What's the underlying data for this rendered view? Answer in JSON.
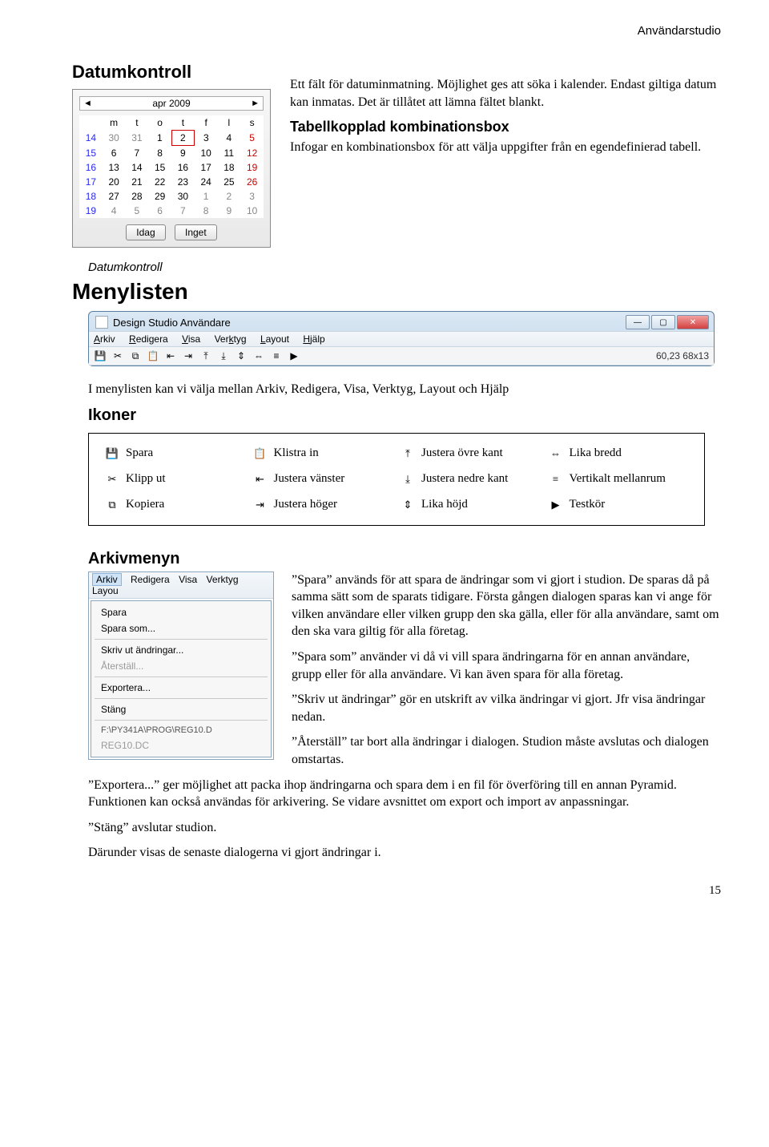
{
  "running_head": "Användarstudio",
  "datumkontroll": {
    "title": "Datumkontroll",
    "para1": "Ett fält för datuminmatning. Möjlighet ges att söka i kalender. Endast giltiga datum kan inmatas. Det är tillåtet att lämna fältet blankt.",
    "sub_title": "Tabellkopplad kombinationsbox",
    "para2": "Infogar en kombinationsbox för att välja uppgifter från en egendefinierad tabell.",
    "caption": "Datumkontroll"
  },
  "calendar": {
    "month": "apr 2009",
    "prev": "◄",
    "next": "►",
    "dow": [
      "m",
      "t",
      "o",
      "t",
      "f",
      "l",
      "s"
    ],
    "rows": [
      {
        "wk": "14",
        "d": [
          "30",
          "31",
          "1",
          "2",
          "3",
          "4",
          "5"
        ],
        "dim": [
          0,
          1
        ],
        "today": 3,
        "red": [
          6
        ]
      },
      {
        "wk": "15",
        "d": [
          "6",
          "7",
          "8",
          "9",
          "10",
          "11",
          "12"
        ],
        "red": [
          6
        ]
      },
      {
        "wk": "16",
        "d": [
          "13",
          "14",
          "15",
          "16",
          "17",
          "18",
          "19"
        ],
        "red": [
          6
        ]
      },
      {
        "wk": "17",
        "d": [
          "20",
          "21",
          "22",
          "23",
          "24",
          "25",
          "26"
        ],
        "red": [
          6
        ]
      },
      {
        "wk": "18",
        "d": [
          "27",
          "28",
          "29",
          "30",
          "1",
          "2",
          "3"
        ],
        "dim": [
          4,
          5,
          6
        ],
        "red": [
          6
        ]
      },
      {
        "wk": "19",
        "d": [
          "4",
          "5",
          "6",
          "7",
          "8",
          "9",
          "10"
        ],
        "dim": [
          0,
          1,
          2,
          3,
          4,
          5,
          6
        ],
        "red": [
          6
        ]
      }
    ],
    "btn_today": "Idag",
    "btn_none": "Inget"
  },
  "menylisten": {
    "title": "Menylisten",
    "window_title": "Design Studio Användare",
    "menus": {
      "arkiv": "Arkiv",
      "redigera": "Redigera",
      "visa": "Visa",
      "verktyg": "Verktyg",
      "layout": "Layout",
      "hjalp": "Hjälp"
    },
    "status": "60,23 68x13",
    "intro": "I menylisten kan vi välja mellan  Arkiv, Redigera, Visa, Verktyg, Layout och Hjälp",
    "ikoner_title": "Ikoner"
  },
  "legend": {
    "spara": "Spara",
    "klipp": "Klipp ut",
    "kopiera": "Kopiera",
    "klistra": "Klistra in",
    "jvanster": "Justera vänster",
    "jhoger": "Justera höger",
    "jovre": "Justera övre kant",
    "jnedre": "Justera nedre kant",
    "likahojd": "Lika höjd",
    "likabredd": "Lika bredd",
    "vertmellan": "Vertikalt mellanrum",
    "testkor": "Testkör"
  },
  "arkiv": {
    "title": "Arkivmenyn",
    "menubar": {
      "arkiv": "Arkiv",
      "redigera": "Redigera",
      "visa": "Visa",
      "verktyg": "Verktyg",
      "layou": "Layou"
    },
    "items": {
      "spara": "Spara",
      "sparasom": "Spara som...",
      "skrivut": "Skriv ut ändringar...",
      "aterstall": "Återställ...",
      "exportera": "Exportera...",
      "stang": "Stäng",
      "path": "F:\\PY341A\\PROG\\REG10.D",
      "file": "REG10.DC"
    },
    "p1": "”Spara” används för att spara de ändringar som vi gjort i studion. De sparas då på samma sätt som de sparats tidigare. Första gången dialogen sparas kan vi ange för vilken användare eller  vilken grupp den ska gälla, eller för alla användare, samt om den ska vara giltig för alla företag.",
    "p2": "”Spara som” använder vi då vi vill spara ändringarna för en annan användare, grupp eller för alla användare. Vi kan även spara för alla företag.",
    "p3": "”Skriv ut ändringar” gör en utskrift av vilka ändringar vi gjort. Jfr visa ändringar nedan.",
    "p4": "”Återställ” tar bort alla ändringar i dialogen. Studion måste avslutas och dia­logen omstartas.",
    "p5": "”Exportera...” ger möjlighet att packa ihop ändringarna och spara dem i en fil för överföring till en annan Pyramid. Funktionen kan också användas för arkivering. Se vidare avsnittet om export och import av anpassningar.",
    "p6": "”Stäng” avslutar studion.",
    "p7": "Därunder visas de senaste dialogerna vi gjort ändringar i."
  },
  "page_number": "15"
}
